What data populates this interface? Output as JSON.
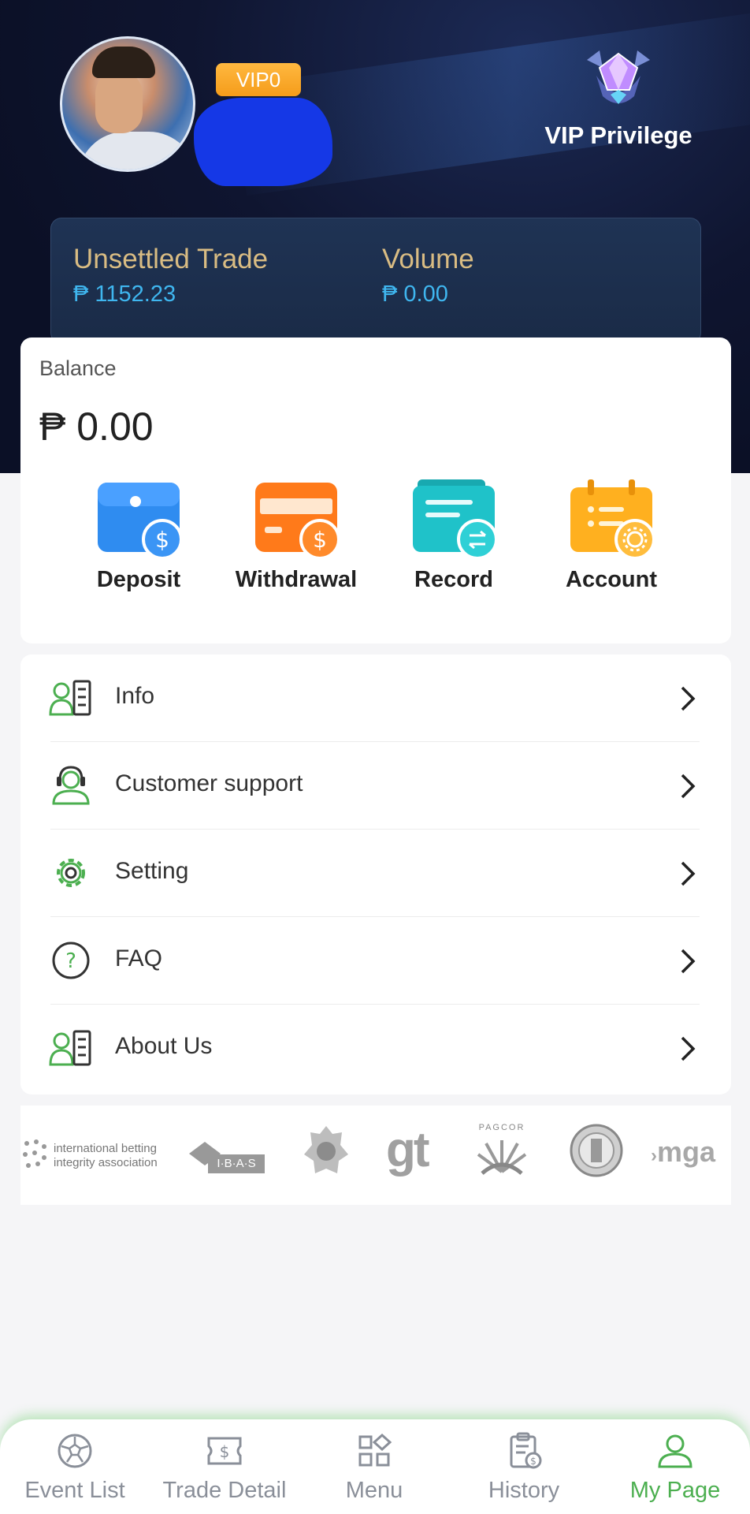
{
  "header": {
    "vip_level": "VIP0",
    "vip_privilege_label": "VIP Privilege"
  },
  "trade_summary": {
    "unsettled_label": "Unsettled Trade",
    "unsettled_value": "₱ 1152.23",
    "volume_label": "Volume",
    "volume_value": "₱ 0.00"
  },
  "balance": {
    "label": "Balance",
    "amount": "₱ 0.00"
  },
  "actions": [
    {
      "label": "Deposit",
      "icon": "wallet-dollar-icon",
      "color": "#2f8cf0"
    },
    {
      "label": "Withdrawal",
      "icon": "card-dollar-icon",
      "color": "#ff7a1a"
    },
    {
      "label": "Record",
      "icon": "record-transfer-icon",
      "color": "#1fc2c9"
    },
    {
      "label": "Account",
      "icon": "calendar-gear-icon",
      "color": "#ffb01f"
    }
  ],
  "menu": [
    {
      "label": "Info",
      "icon": "id-card-icon"
    },
    {
      "label": "Customer support",
      "icon": "headset-agent-icon"
    },
    {
      "label": "Setting",
      "icon": "gear-icon"
    },
    {
      "label": "FAQ",
      "icon": "question-circle-icon"
    },
    {
      "label": "About Us",
      "icon": "id-card-icon"
    }
  ],
  "partners": {
    "ibia_line1": "international betting",
    "ibia_line2": "integrity association",
    "ibas": "I·B·A·S",
    "gt": "gt",
    "pagcor": "PAGCOR",
    "mga": "mga"
  },
  "bottom_nav": [
    {
      "label": "Event List",
      "icon": "soccer-ball-icon",
      "active": false
    },
    {
      "label": "Trade Detail",
      "icon": "ticket-dollar-icon",
      "active": false
    },
    {
      "label": "Menu",
      "icon": "grid-menu-icon",
      "active": false
    },
    {
      "label": "History",
      "icon": "clipboard-dollar-icon",
      "active": false
    },
    {
      "label": "My Page",
      "icon": "user-icon",
      "active": true
    }
  ],
  "colors": {
    "accent_green": "#4caf50",
    "gold_label": "#d9bc83",
    "value_blue": "#3fb6ef",
    "vip_orange": "#f59c1a"
  }
}
